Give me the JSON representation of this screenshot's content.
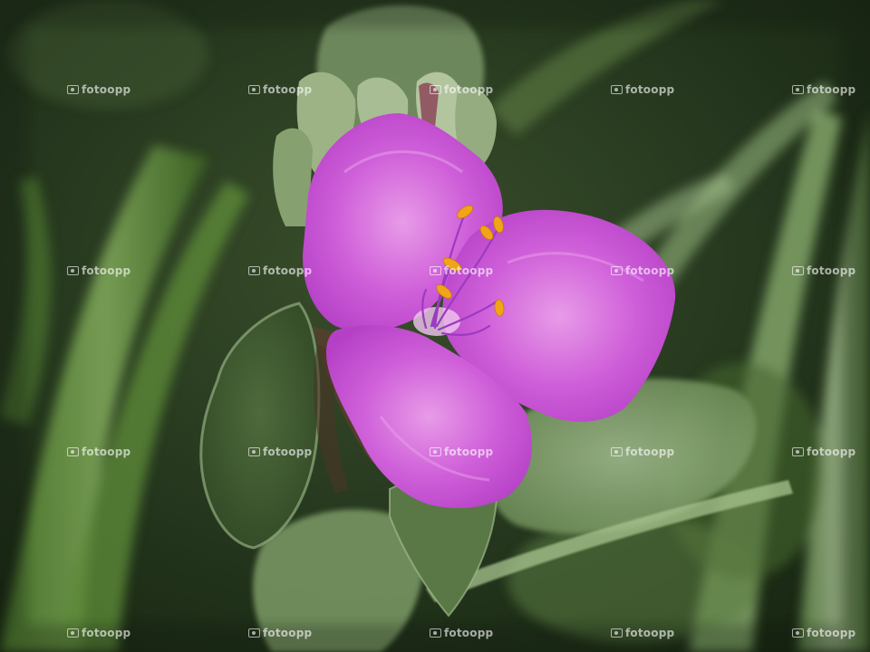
{
  "image": {
    "watermark": "fotoopp",
    "subject": "purple-flower",
    "colors": {
      "petal": "#c94fd6",
      "petal_light": "#e08ae6",
      "stamen": "#f0a418",
      "filament": "#a23fc4",
      "foliage_dark": "#22331c",
      "foliage_mid": "#5f7d45",
      "foliage_light": "#a9c596"
    }
  }
}
